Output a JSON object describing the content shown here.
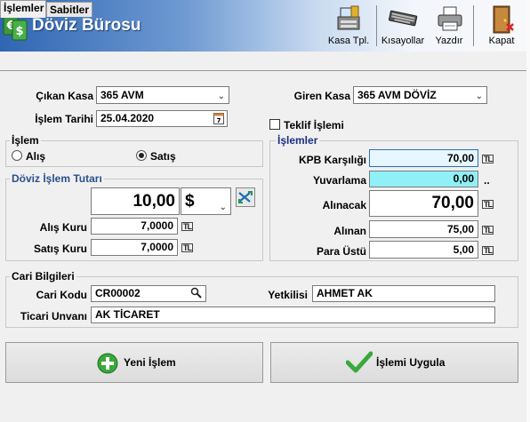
{
  "app": {
    "title": "Döviz Bürosu"
  },
  "toolbar": {
    "kasa_label": "Kasa Tpl.",
    "kisayollar_label": "Kısayollar",
    "yazdir_label": "Yazdır",
    "kapat_label": "Kapat"
  },
  "tabs": [
    {
      "label": "İşlemler"
    },
    {
      "label": "Sabitler"
    }
  ],
  "top": {
    "cikan_kasa_label": "Çıkan Kasa",
    "cikan_kasa_value": "365 AVM",
    "islem_tarihi_label": "İşlem Tarihi",
    "islem_tarihi_value": "25.04.2020",
    "giren_kasa_label": "Giren Kasa",
    "giren_kasa_value": "365 AVM DÖVİZ",
    "teklif_label": "Teklif İşlemi"
  },
  "islem_group": {
    "title": "İşlem",
    "alis_label": "Alış",
    "satis_label": "Satış",
    "selected": "Satış"
  },
  "doviz_group": {
    "title": "Döviz İşlem Tutarı",
    "amount": "10,00",
    "currency": "$",
    "alis_kuru_label": "Alış Kuru",
    "alis_kuru_value": "7,0000",
    "satis_kuru_label": "Satış Kuru",
    "satis_kuru_value": "7,0000"
  },
  "islemler_group": {
    "title": "İşlemler",
    "kpb_label": "KPB Karşılığı",
    "kpb_value": "70,00",
    "yuvarlama_label": "Yuvarlama",
    "yuvarlama_value": "0,00",
    "alinacak_label": "Alınacak",
    "alinacak_value": "70,00",
    "alinan_label": "Alınan",
    "alinan_value": "75,00",
    "para_ustu_label": "Para Üstü",
    "para_ustu_value": "5,00"
  },
  "cari_group": {
    "title": "Cari Bilgileri",
    "cari_kodu_label": "Cari Kodu",
    "cari_kodu_value": "CR00002",
    "yetkilisi_label": "Yetkilisi",
    "yetkilisi_value": "AHMET AK",
    "ticari_unvani_label": "Ticari Unvanı",
    "ticari_unvani_value": "AK TİCARET"
  },
  "buttons": {
    "yeni_label": "Yeni İşlem",
    "uygula_label": "İşlemi Uygula"
  },
  "currency_badge": "TL",
  "colors": {
    "header_blue": "#2f66b3",
    "highlight_cyan": "#8ff0f7",
    "active_field": "#e6f7ff"
  },
  "icons": [
    "money-icon",
    "cash-register-icon",
    "keyboard-icon",
    "printer-icon",
    "exit-door-icon",
    "calendar-icon",
    "swap-icon",
    "search-icon",
    "plus-icon",
    "check-icon"
  ]
}
